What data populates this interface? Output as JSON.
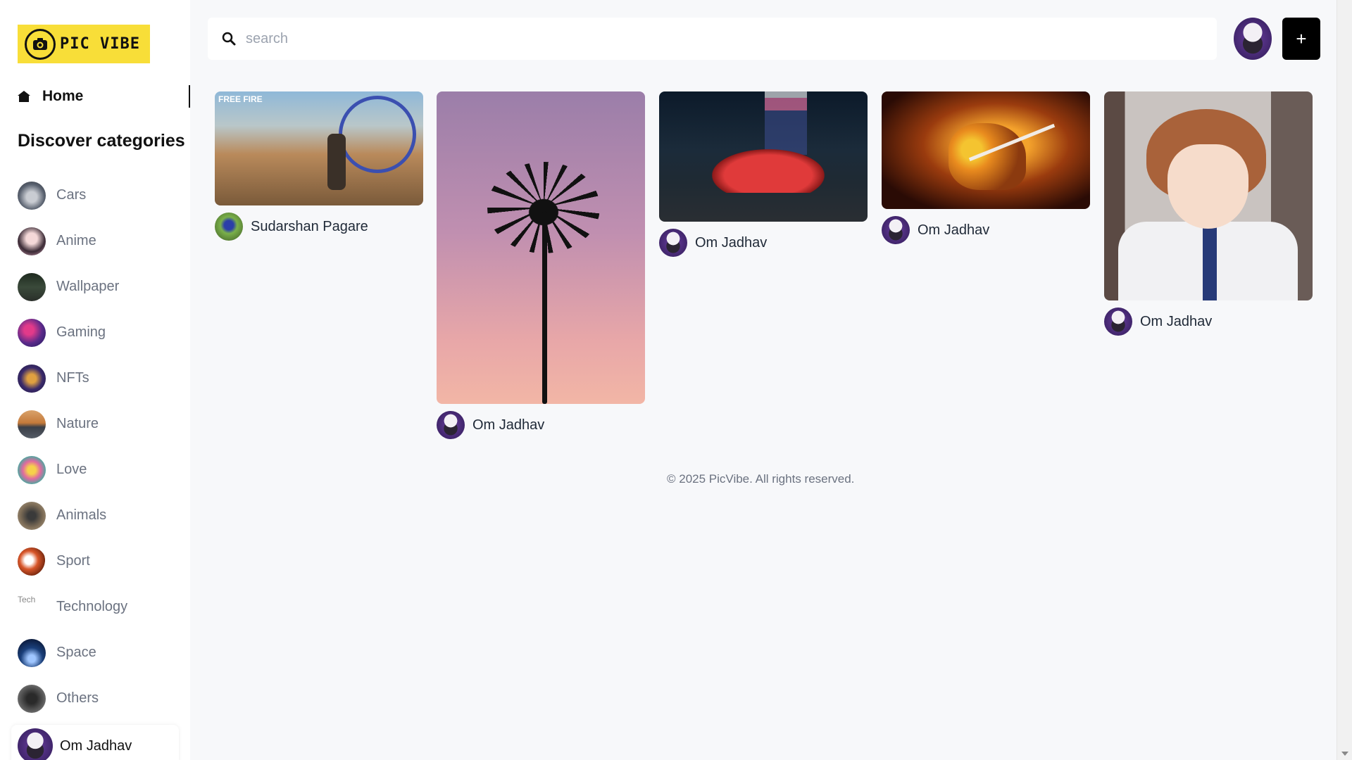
{
  "app": {
    "logo_text": "PIC VIBE"
  },
  "sidebar": {
    "home_label": "Home",
    "discover_title": "Discover categories",
    "categories": [
      {
        "label": "Cars",
        "icon": "cars-thumb",
        "color": "#5a6270"
      },
      {
        "label": "Anime",
        "icon": "anime-thumb",
        "color": "#d8a3b8"
      },
      {
        "label": "Wallpaper",
        "icon": "wallpaper-thumb",
        "color": "#2f3a2c"
      },
      {
        "label": "Gaming",
        "icon": "gaming-thumb",
        "color": "#5b2a8a"
      },
      {
        "label": "NFTs",
        "icon": "nfts-thumb",
        "color": "#3a2a6a"
      },
      {
        "label": "Nature",
        "icon": "nature-thumb",
        "color": "#c57a3a"
      },
      {
        "label": "Love",
        "icon": "love-thumb",
        "color": "#e06aa0"
      },
      {
        "label": "Animals",
        "icon": "animals-thumb",
        "color": "#7a6a55"
      },
      {
        "label": "Sport",
        "icon": "sport-thumb",
        "color": "#d8562a"
      },
      {
        "label": "Technology",
        "icon": "technology-broken-image",
        "broken_alt": "Tech"
      },
      {
        "label": "Space",
        "icon": "space-thumb",
        "color": "#1a3f7a"
      },
      {
        "label": "Others",
        "icon": "others-thumb",
        "color": "#5a5a5a"
      }
    ],
    "user": {
      "name": "Om Jadhav"
    }
  },
  "search": {
    "placeholder": "search",
    "value": ""
  },
  "header": {
    "add_label": "+"
  },
  "pins": [
    {
      "user": "Sudarshan Pagare",
      "image": "free-fire-scene",
      "image_text": "FREE FIRE"
    },
    {
      "user": "Om Jadhav",
      "image": "palm-tree-sunset"
    },
    {
      "user": "Om Jadhav",
      "image": "red-sports-car-night"
    },
    {
      "user": "Om Jadhav",
      "image": "anime-sword-fighter"
    },
    {
      "user": "Om Jadhav",
      "image": "anime-student-portrait"
    }
  ],
  "footer": {
    "text": "© 2025 PicVibe. All rights reserved."
  }
}
